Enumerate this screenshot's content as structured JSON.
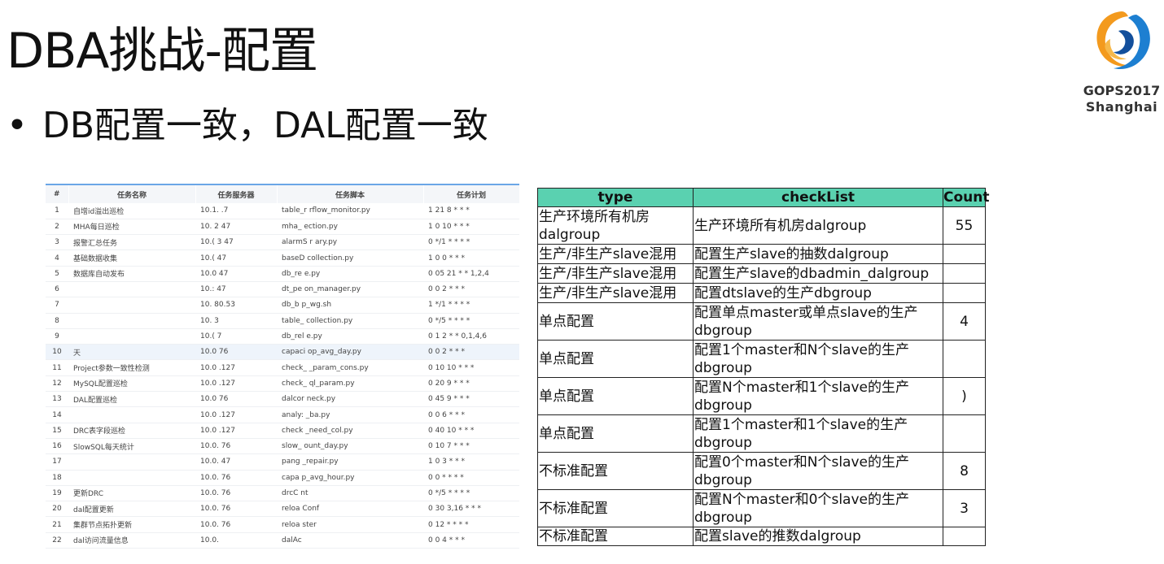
{
  "slide": {
    "title": "DBA挑战-配置",
    "bullet_marker": "•",
    "bullet_text": "DB配置一致，DAL配置一致"
  },
  "logo": {
    "line1": "GOPS2017",
    "line2": "Shanghai",
    "colors": {
      "orange": "#f39a1e",
      "blue": "#1d7fd1",
      "dark_blue": "#124f9c"
    }
  },
  "task_table": {
    "headers": [
      "#",
      "任务名称",
      "任务服务器",
      "任务脚本",
      "任务计划"
    ],
    "rows": [
      [
        "1",
        "自增id溢出巡检",
        "10.1.  .7",
        "table_r  rflow_monitor.py",
        "1 21 8 * * *"
      ],
      [
        "2",
        "MHA每日巡检",
        "10.  2  47",
        "mha_    ection.py",
        "1 0 10 * * *"
      ],
      [
        "3",
        "报警汇总任务",
        "10.(  3  47",
        "alarmS  r ary.py",
        "0 */1 * * * *"
      ],
      [
        "4",
        "基础数据收集",
        "10.(   47",
        "baseD   collection.py",
        "1 0 0 * * *"
      ],
      [
        "5",
        "数据库自动发布",
        "10.0   47",
        "db_re   e.py",
        "0 05 21 * * 1,2,4"
      ],
      [
        "6",
        "",
        "10.:  47",
        "dt_pe  on_manager.py",
        "0 0 2 * * *"
      ],
      [
        "7",
        "",
        "10.  80.53",
        "db_b   p_wg.sh",
        "1 */1 * * * *"
      ],
      [
        "8",
        "",
        "10.   3",
        "table_   collection.py",
        "0 */5 * * * *"
      ],
      [
        "9",
        "",
        "10.(   7",
        "db_rel   e.py",
        "0 1 2 * * 0,1,4,6"
      ],
      [
        "10",
        "天",
        "10.0   76",
        "capaci   op_avg_day.py",
        "0 0 2 * * *"
      ],
      [
        "11",
        "Project参数一致性检测",
        "10.0    .127",
        "check_   _param_cons.py",
        "0 10 10 * * *"
      ],
      [
        "12",
        "MySQL配置巡检",
        "10.0   .127",
        "check_   ql_param.py",
        "0 20 9 * * *"
      ],
      [
        "13",
        "DAL配置巡检",
        "10.0   76",
        "dalcor   neck.py",
        "0 45 9 * * *"
      ],
      [
        "14",
        "",
        "10.0   .127",
        "analy:   _ba.py",
        "0 0 6 * * *"
      ],
      [
        "15",
        "DRC表字段巡检",
        "10.0   .127",
        "check   _need_col.py",
        "0 40 10 * * *"
      ],
      [
        "16",
        "SlowSQL每天统计",
        "10.0.   76",
        "slow_  ount_day.py",
        "0 10 7 * * *"
      ],
      [
        "17",
        "",
        "10.0.   47",
        "pang   _repair.py",
        "1 0 3 * * *"
      ],
      [
        "18",
        "",
        "10.0.   76",
        "capa   p_avg_hour.py",
        "0 0 * * * *"
      ],
      [
        "19",
        "更新DRC",
        "10.0.   76",
        "drcC   nt",
        "0 */5 * * * *"
      ],
      [
        "20",
        "dal配置更新",
        "10.0.   76",
        "reloa   Conf",
        "0 30 3,16 * * *"
      ],
      [
        "21",
        "集群节点拓扑更新",
        "10.0.  76",
        "reloa   ster",
        "0 12 * * * *"
      ],
      [
        "22",
        "dal访问流量信息",
        "10.0.",
        "dalAc",
        "0 0 4 * * *"
      ]
    ]
  },
  "check_table": {
    "headers": {
      "type": "type",
      "checklist": "checkList",
      "count": "Count"
    },
    "rows": [
      {
        "type": "生产环境所有机房dalgroup",
        "checklist": "生产环境所有机房dalgroup",
        "count": "55"
      },
      {
        "type": "生产/非生产slave混用",
        "checklist": "配置生产slave的抽数dalgroup",
        "count": ""
      },
      {
        "type": "生产/非生产slave混用",
        "checklist": "配置生产slave的dbadmin_dalgroup",
        "count": ""
      },
      {
        "type": "生产/非生产slave混用",
        "checklist": "配置dtslave的生产dbgroup",
        "count": ""
      },
      {
        "type": "单点配置",
        "checklist": "配置单点master或单点slave的生产dbgroup",
        "count": "4"
      },
      {
        "type": "单点配置",
        "checklist": "配置1个master和N个slave的生产dbgroup",
        "count": ""
      },
      {
        "type": "单点配置",
        "checklist": "配置N个master和1个slave的生产dbgroup",
        "count": ")"
      },
      {
        "type": "单点配置",
        "checklist": "配置1个master和1个slave的生产dbgroup",
        "count": ""
      },
      {
        "type": "不标准配置",
        "checklist": "配置0个master和N个slave的生产dbgroup",
        "count": "8"
      },
      {
        "type": "不标准配置",
        "checklist": "配置N个master和0个slave的生产dbgroup",
        "count": "3"
      },
      {
        "type": "不标准配置",
        "checklist": "配置slave的推数dalgroup",
        "count": ""
      }
    ]
  }
}
